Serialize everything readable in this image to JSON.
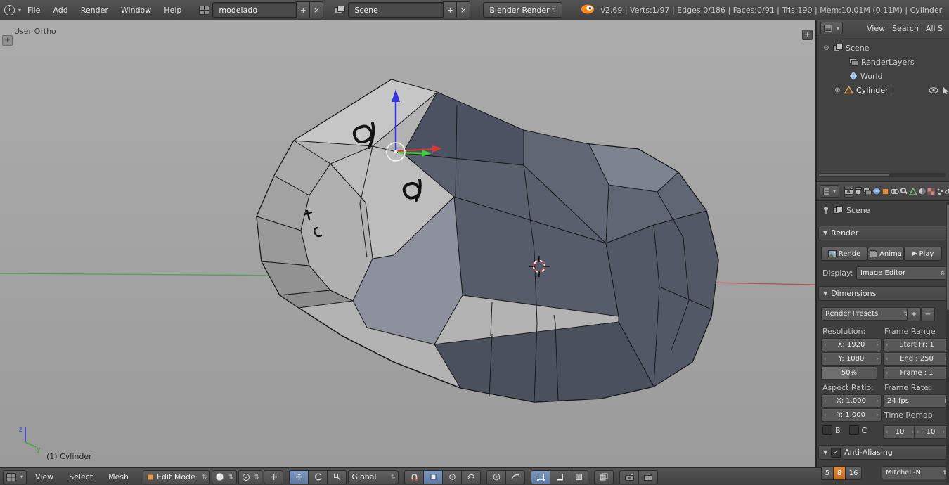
{
  "header": {
    "editor_menus": [
      "File",
      "Add",
      "Render",
      "Window",
      "Help"
    ],
    "screen": {
      "value": "modelado",
      "add": "+",
      "close": "×"
    },
    "scene": {
      "value": "Scene",
      "add": "+",
      "close": "×"
    },
    "engine": "Blender Render",
    "stats": "v2.69 | Verts:1/97 | Edges:0/186 | Faces:0/91 | Tris:190 | Mem:10.01M (0.11M) | Cylinder"
  },
  "viewport": {
    "view_label": "User Ortho",
    "object_info": "(1) Cylinder",
    "axis": {
      "z": "z",
      "y": "y"
    }
  },
  "outliner": {
    "menu": [
      "View",
      "Search",
      "All S"
    ],
    "items": [
      {
        "label": "Scene"
      },
      {
        "label": "RenderLayers"
      },
      {
        "label": "World"
      },
      {
        "label": "Cylinder"
      }
    ]
  },
  "properties": {
    "context": "Scene",
    "render": {
      "title": "Render",
      "render_btn": "Rende",
      "anim_btn": "Anima",
      "play_btn": "Play",
      "display_label": "Display:",
      "display_value": "Image Editor"
    },
    "dimensions": {
      "title": "Dimensions",
      "presets": "Render Presets",
      "add": "+",
      "remove": "−",
      "resolution_label": "Resolution:",
      "frame_range_label": "Frame Range",
      "res_x": "X: 1920",
      "res_y": "Y: 1080",
      "res_scale": "50%",
      "start": "Start Fr: 1",
      "end": "End : 250",
      "frame": "Frame : 1",
      "aspect_label": "Aspect Ratio:",
      "frame_rate_label": "Frame Rate:",
      "aspect_x": "X: 1.000",
      "aspect_y": "Y: 1.000",
      "fps": "24 fps",
      "time_remap_label": "Time Remap",
      "border": "B",
      "crop": "C",
      "old_map": "10",
      "new_map": "10"
    },
    "anti_aliasing": {
      "title": "Anti-Aliasing",
      "samples": [
        "5",
        "8",
        "16"
      ],
      "filter": "Mitchell-N"
    }
  },
  "footer": {
    "menus": [
      "View",
      "Select",
      "Mesh"
    ],
    "mode": "Edit Mode",
    "orientation": "Global"
  }
}
